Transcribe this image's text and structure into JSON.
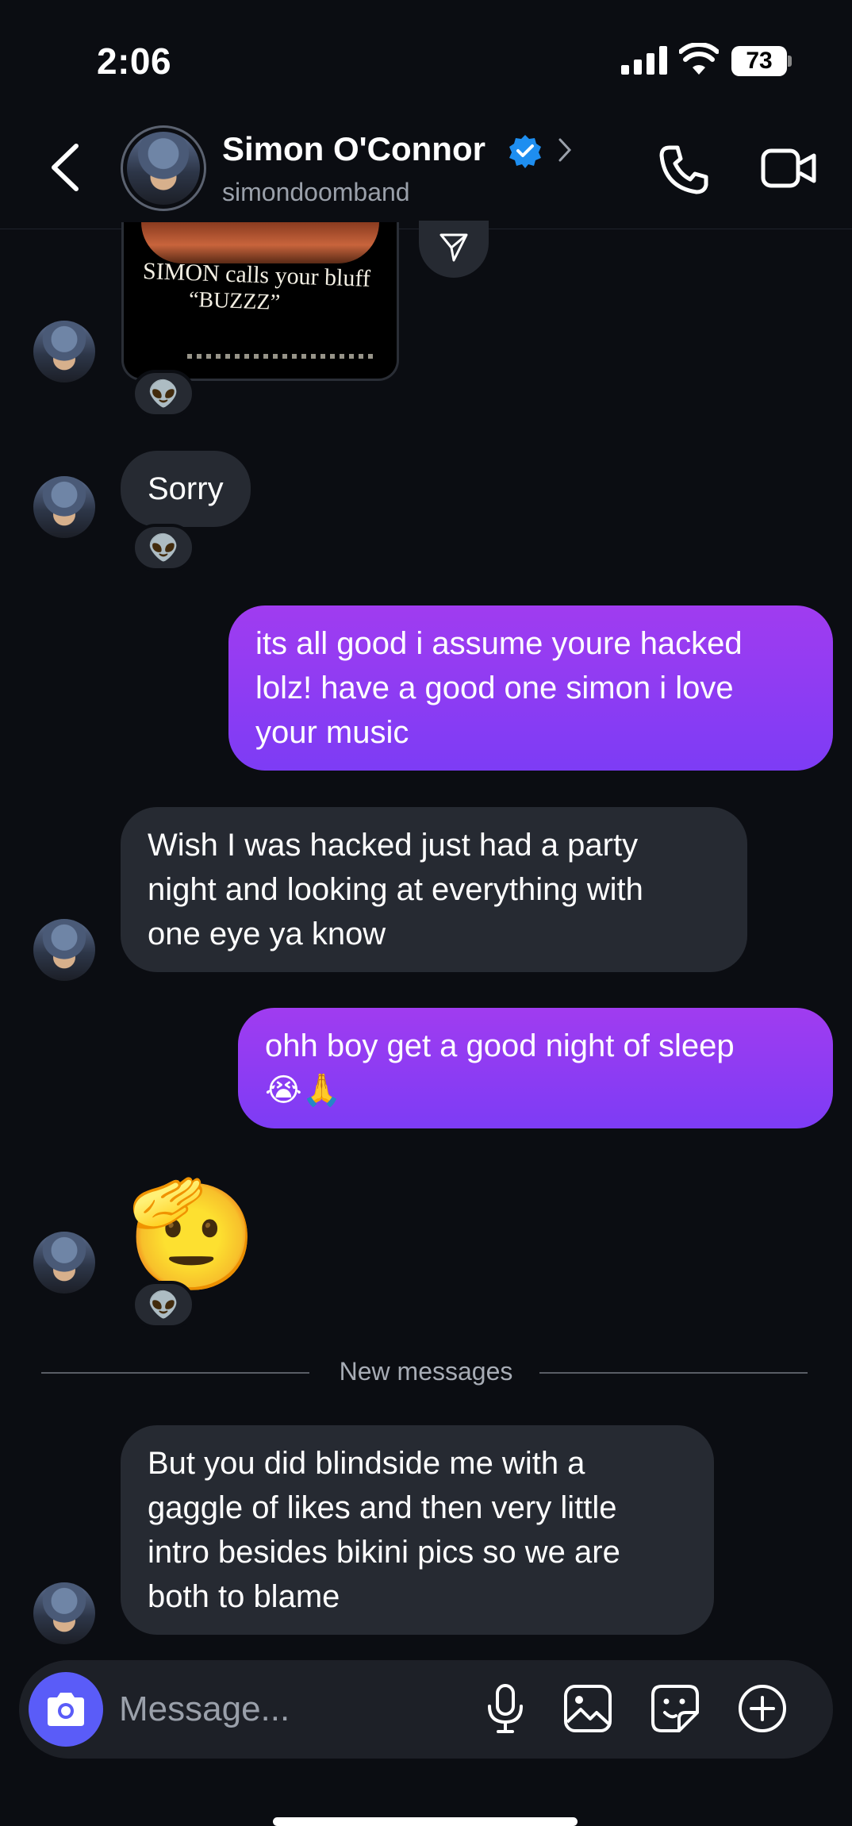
{
  "status_bar": {
    "time": "2:06",
    "battery": "73"
  },
  "header": {
    "contact_name": "Simon O'Connor",
    "handle": "simondoomband",
    "icons": [
      "back-arrow-icon",
      "verified-badge-icon",
      "chevron-right-icon",
      "phone-icon",
      "video-camera-icon"
    ]
  },
  "shared_photo": {
    "line1": "SIMON calls your bluff",
    "line2": "“BUZZZ”",
    "reaction": "👽"
  },
  "messages": [
    {
      "from": "contact",
      "lines": [
        "Sorry"
      ],
      "reaction": "👽"
    },
    {
      "from": "me",
      "lines": [
        "its all good i assume youre hacked",
        "lolz! have a good one simon i love",
        "your music"
      ]
    },
    {
      "from": "contact",
      "lines": [
        "Wish I was hacked just had a party",
        "night and looking at everything with",
        "one eye ya know"
      ]
    },
    {
      "from": "me",
      "lines": [
        "ohh boy get a good night of sleep",
        "😭🙏"
      ]
    },
    {
      "from": "contact",
      "emoji": "🫡",
      "reaction": "👽"
    },
    {
      "from": "contact",
      "lines": [
        "But you did blindside me with a",
        "gaggle of likes and then very little",
        "intro besides bikini pics so we are",
        "both to blame"
      ]
    }
  ],
  "new_messages_label": "New messages",
  "composer": {
    "placeholder": "Message...",
    "icons": [
      "camera-icon",
      "microphone-icon",
      "gallery-icon",
      "sticker-icon",
      "add-icon"
    ]
  },
  "colors": {
    "background": "#0b0d12",
    "incoming_bubble": "#262a32",
    "outgoing_bubble": "#8a3cf2",
    "camera_button": "#5a5cf8"
  }
}
